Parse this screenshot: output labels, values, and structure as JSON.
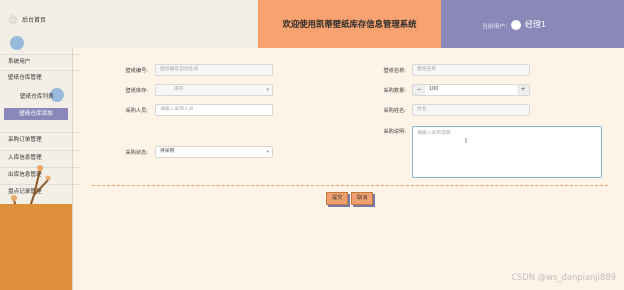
{
  "sidebar": {
    "home": "后台首页",
    "items": [
      {
        "label": "系统用户"
      },
      {
        "label": "壁纸仓库管理"
      },
      {
        "label": "壁纸仓库列表"
      },
      {
        "label": "壁纸仓库添加"
      },
      {
        "label": "采购订单管理"
      },
      {
        "label": "入库信息管理"
      },
      {
        "label": "出库信息管理"
      },
      {
        "label": "盘点记录管理"
      }
    ]
  },
  "header": {
    "title": "欢迎使用凯蒂壁纸库存信息管理系统",
    "user_label": "当前用户:",
    "user_name": "经理1"
  },
  "form": {
    "left": [
      {
        "label": "壁纸编号:",
        "placeholder": "壁纸编号自动生成"
      },
      {
        "label": "壁纸库存:",
        "placeholder": "库存"
      },
      {
        "label": "采购人员:",
        "placeholder": "请输入采购人员"
      },
      {
        "label": "采购状态:",
        "value": "待采购"
      }
    ],
    "right": [
      {
        "label": "壁纸名称:",
        "placeholder": "壁纸名称"
      },
      {
        "label": "采购数量:",
        "value": "100",
        "minus": "−",
        "plus": "+"
      },
      {
        "label": "采购姓名:",
        "placeholder": "姓名"
      },
      {
        "label": "采购说明:",
        "placeholder": "请输入采购说明"
      }
    ]
  },
  "buttons": {
    "submit": "提交",
    "cancel": "取消"
  },
  "watermark": "CSDN @ws_danpianji889"
}
